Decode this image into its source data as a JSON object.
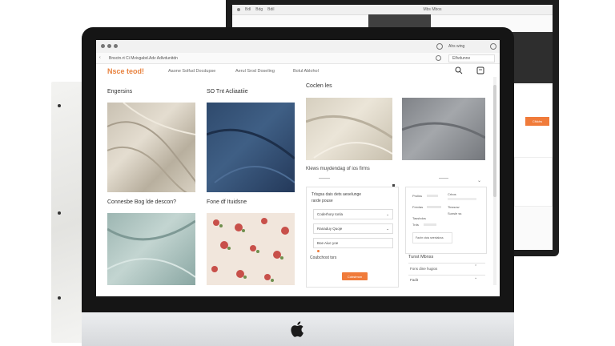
{
  "background_window": {
    "tabs": [
      "Bdl",
      "Bdg",
      "Bdil"
    ],
    "right_text": "Mbs Mbos",
    "button_label": "Cfkkhs"
  },
  "browser": {
    "address": "Bnsctn.rt Ci    Mvivgabd.Adv   Adlvdunitdn",
    "right_nav": "Ahs wing",
    "search_placeholder": "Elfvdunne"
  },
  "site": {
    "brand": "Nsce teod!",
    "nav": [
      "Aaone Solfud Docdupse",
      "Aerul Srod Doseling",
      "Bolul Ablohol"
    ]
  },
  "categories": [
    {
      "title": "Engersins"
    },
    {
      "title": "SO Tnt Acliaatiie"
    },
    {
      "title": "Connesbe Bog lde descon?"
    },
    {
      "title": "Fone df Ituidsne"
    }
  ],
  "right_column": {
    "title": "Coclen les",
    "subtitle": "Klews muydendag of ios firms",
    "filter": {
      "title_line1": "Trlsgsa dais dets aeselunge",
      "title_line2": "rarde pouse",
      "options": [
        "Coderhory tonla",
        "Ranaduy Quoje",
        "Boe Aiuc yoe"
      ],
      "footer": "Coubchost tsrs",
      "apply": "Cobstmon"
    },
    "details": {
      "left": [
        "Proliss",
        "Frevlas",
        "Tasshdos",
        "Trds"
      ],
      "right": [
        "Crbos",
        "Tinssow",
        "Sunsle ss"
      ],
      "footnote": "Faohr ctcis seenlaloss"
    },
    "related": {
      "title": "Tunst Mbnss",
      "items": [
        "Fons dine hugios",
        "Fadit"
      ]
    }
  },
  "colors": {
    "accent": "#f07b3a",
    "brand": "#e8823f"
  },
  "icons": [
    "search-icon",
    "cart-icon",
    "chevron-down-icon",
    "apple-logo-icon"
  ]
}
